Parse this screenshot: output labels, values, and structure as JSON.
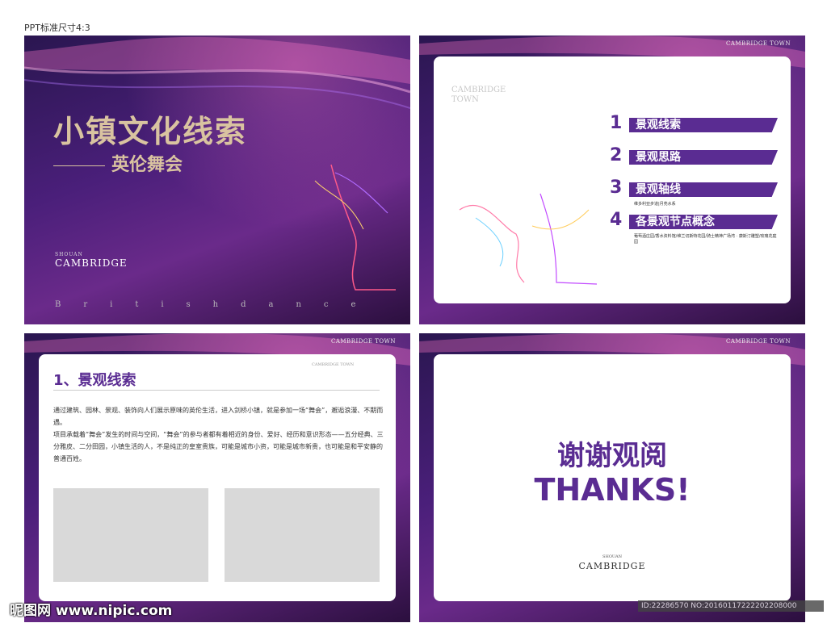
{
  "top_label": "PPT标准尺寸4:3",
  "slide1": {
    "title": "小镇文化线索",
    "subtitle": "英伦舞会",
    "brand_small": "SHOUAN",
    "brand": "CAMBRIDGE",
    "tagline": "Britishdance"
  },
  "slide2": {
    "corner_brand": "CAMBRIDGE TOWN",
    "brand": "CAMBRIDGE\nTOWN",
    "menu": [
      {
        "num": "1",
        "label": "景观线索"
      },
      {
        "num": "2",
        "label": "景观思路"
      },
      {
        "num": "3",
        "label": "景观轴线"
      },
      {
        "num": "4",
        "label": "各景观节点概念"
      }
    ],
    "note3": "维多利亚步道|月亮水系",
    "note4": "葡萄酒庄园/香水资料馆/维兰切斯特花园/骑士精神广场湾 · 康斯汀雕塑/玫瑰花庭园"
  },
  "slide3": {
    "corner_brand": "CAMBRIDGE TOWN",
    "heading": "1、景观线索",
    "logo": "CAMBRIDGE TOWN",
    "para1": "通过建筑、园林、景观、装饰向人们展示原味的英伦生活，进入剑桥小镇，就是参加一场“舞会”，邂逅浪漫、不期而遇。",
    "para2": "项目承载着“舞会”发生的时间与空间，“舞会”的参与者都有着相近的身份、爱好、经历和意识形态——五分经典、三分雅皮、二分田园，小镇生活的人，不是纯正的皇室贵族，可能是城市小资，可能是城市新贵，也可能是和平安静的普通百姓。"
  },
  "slide4": {
    "corner_brand": "CAMBRIDGE TOWN",
    "cn": "谢谢观阅",
    "en": "THANKS!",
    "brand_small": "SHOUAN",
    "brand": "CAMBRIDGE"
  },
  "watermark": "昵图网 www.nipic.com",
  "idline": "ID:22286570 NO:20160117222202208000",
  "colors": {
    "accent": "#5a2c92",
    "gold": "#d9c3a0"
  }
}
